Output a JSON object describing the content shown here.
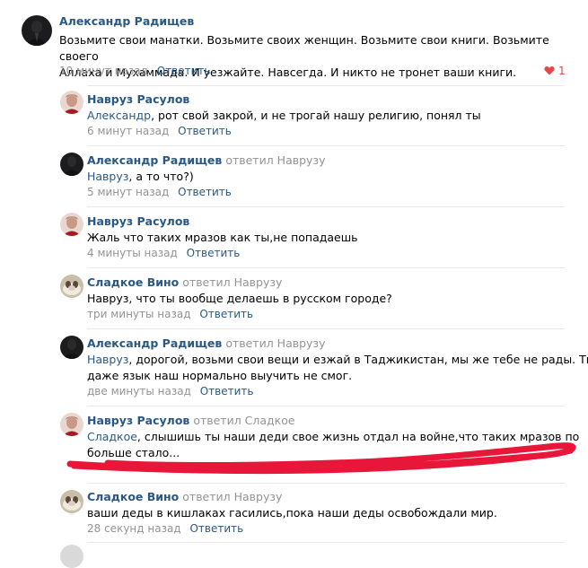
{
  "comments": [
    {
      "author": "Александр Радищев",
      "replied": "",
      "lines": [
        "Возьмите свои манатки. Возьмите своих женщин. Возьмите свои книги. Возьмите своего",
        "Аллаха и Мухаммада. И уезжайте. Навсегда. И никто не тронет ваши книги."
      ],
      "time": "10 минут назад",
      "reply": "Ответить",
      "likes": "1"
    },
    {
      "author": "Навруз Расулов",
      "replied": "",
      "mention": "Александр",
      "text": ", рот свой закрой, и не трогай нашу религию, понял ты",
      "time": "6 минут назад",
      "reply": "Ответить"
    },
    {
      "author": "Александр Радищев",
      "replied": "ответил Наврузу",
      "mention": "Навруз",
      "text": ", а то что?)",
      "time": "5 минут назад",
      "reply": "Ответить"
    },
    {
      "author": "Навруз Расулов",
      "replied": "",
      "text": "Жаль что таких мразов как ты,не попадаешь",
      "time": "4 минуты назад",
      "reply": "Ответить"
    },
    {
      "author": "Сладкое Вино",
      "replied": "ответил Наврузу",
      "text": "Навруз, что ты вообще делаешь в русском городе?",
      "time": "три минуты назад",
      "reply": "Ответить"
    },
    {
      "author": "Александр Радищев",
      "replied": "ответил Наврузу",
      "mention": "Навруз",
      "line1": ", дорогой, возьми свои вещи и езжай в Таджикистан, мы же тебе не рады. Ты",
      "line2": "даже язык наш нормально выучить не смог.",
      "time": "две минуты назад",
      "reply": "Ответить"
    },
    {
      "author": "Навруз Расулов",
      "replied": "ответил Сладкое",
      "mention": "Сладкое",
      "line1": ", слышишь ты наши деди свое жизнь отдал на войне,что таких мразов по",
      "line2": "больше стало..."
    },
    {
      "author": "Сладкое Вино",
      "replied": "ответил Наврузу",
      "text": "ваши деды в кишлаках гасились,пока наши деды освобождали мир.",
      "time": "28 секунд назад",
      "reply": "Ответить"
    }
  ],
  "colors": {
    "link": "#2a5885",
    "meta": "#939393",
    "like": "#e64646",
    "annotation_stroke": "#e8173a"
  },
  "icons": {
    "like": "heart-icon"
  }
}
